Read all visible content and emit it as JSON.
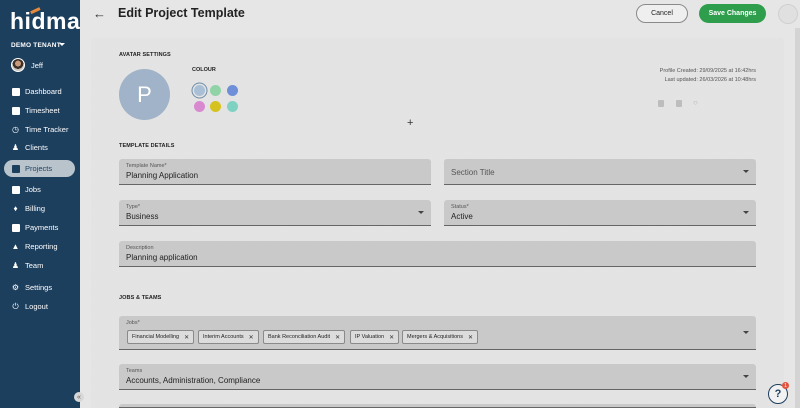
{
  "brand": {
    "logo_text": "hidma"
  },
  "sidebar": {
    "tenant": "DEMO TENANT",
    "user_name": "Jeff",
    "items": [
      {
        "label": "Dashboard",
        "icon": "dashboard-icon",
        "active": false
      },
      {
        "label": "Timesheet",
        "icon": "timesheet-icon",
        "active": false
      },
      {
        "label": "Time Tracker",
        "icon": "clock-icon",
        "active": false
      },
      {
        "label": "Clients",
        "icon": "clients-icon",
        "active": false
      },
      {
        "label": "Projects",
        "icon": "projects-icon",
        "active": true
      },
      {
        "label": "Jobs",
        "icon": "jobs-icon",
        "active": false
      },
      {
        "label": "Billing",
        "icon": "billing-icon",
        "active": false
      },
      {
        "label": "Payments",
        "icon": "payments-icon",
        "active": false
      },
      {
        "label": "Reporting",
        "icon": "reporting-icon",
        "active": false
      },
      {
        "label": "Team",
        "icon": "team-icon",
        "active": false
      },
      {
        "label": "Settings",
        "icon": "gear-icon",
        "active": false
      },
      {
        "label": "Logout",
        "icon": "power-icon",
        "active": false
      }
    ]
  },
  "header": {
    "title": "Edit Project Template",
    "cancel_label": "Cancel",
    "save_label": "Save Changes"
  },
  "avatar_settings": {
    "heading": "AVATAR SETTINGS",
    "initial": "P",
    "colour_label": "COLOUR",
    "swatches": [
      "#a9bfd6",
      "#8fd3a6",
      "#6f8fd9",
      "#d889cf",
      "#d6c21e",
      "#7fd2c2"
    ],
    "selected_swatch": 0,
    "profile_created": "Profile Created: 29/09/2025 at 16:42hrs",
    "last_updated": "Last updated: 26/03/2026 at 10:48hrs"
  },
  "template_details": {
    "heading": "TEMPLATE DETAILS",
    "template_name_label": "Template Name*",
    "template_name_value": "Planning Application",
    "section_title_placeholder": "Section Title",
    "type_label": "Type*",
    "type_value": "Business",
    "status_label": "Status*",
    "status_value": "Active",
    "description_label": "Description",
    "description_value": "Planning application"
  },
  "jobs_teams": {
    "heading": "JOBS & TEAMS",
    "jobs_label": "Jobs*",
    "jobs": [
      "Financial Modelling",
      "Interim Accounts",
      "Bank Reconciliation Audit",
      "IP Valuation",
      "Mergers & Acquisitions"
    ],
    "teams_label": "Teams",
    "teams_value": "Accounts, Administration, Compliance"
  },
  "help": {
    "badge_count": "1",
    "symbol": "?"
  },
  "colors": {
    "sidebar_bg": "#1d3f5e",
    "save_green": "#2e9e4c",
    "active_nav": "#b9c3cc"
  }
}
